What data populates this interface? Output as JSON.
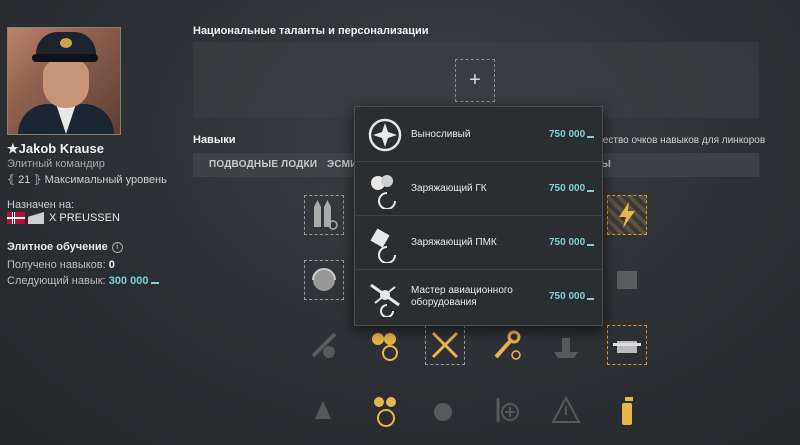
{
  "commander": {
    "name": "Jakob Krause",
    "rank_icon": "star-icon",
    "title": "Элитный командир",
    "level_badge": "21",
    "level_text": "Максимальный уровень",
    "assigned_label": "Назначен на:",
    "ship_name": "X PREUSSEN",
    "elite_label": "Элитное обучение",
    "skills_received_label": "Получено навыков:",
    "skills_received_value": "0",
    "next_skill_label": "Следующий навык:",
    "next_skill_value": "300 000"
  },
  "talents": {
    "title": "Национальные таланты и персонализации",
    "add_label": "+"
  },
  "skills": {
    "title": "Навыки",
    "points_text": "ичество очков навыков для линкоров",
    "tabs": [
      {
        "label": "ПОДВОДНЫЕ ЛОДКИ"
      },
      {
        "label": "ЭСМИ"
      },
      {
        "label": "Ы"
      }
    ]
  },
  "popup": {
    "items": [
      {
        "name": "Выносливый",
        "cost": "750 000",
        "icon": "endurance-cross-icon"
      },
      {
        "name": "Заряжающий ГК",
        "cost": "750 000",
        "icon": "main-battery-loader-icon"
      },
      {
        "name": "Заряжающий ПМК",
        "cost": "750 000",
        "icon": "secondary-battery-loader-icon"
      },
      {
        "name": "Мастер авиационного оборудования",
        "cost": "750 000",
        "icon": "aviation-master-icon"
      }
    ]
  },
  "colors": {
    "accent_cyan": "#7fd0d5",
    "skill_gold": "#e8b64a",
    "background": "#2e3135"
  }
}
